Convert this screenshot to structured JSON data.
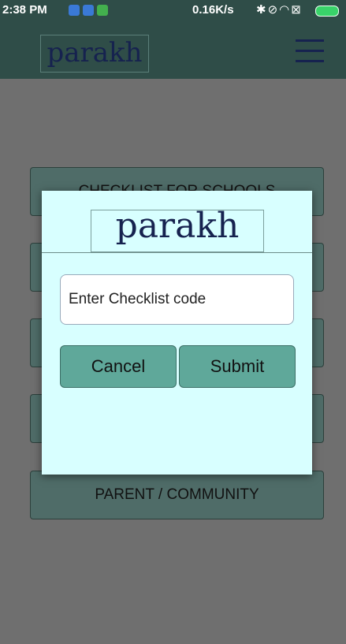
{
  "status_bar": {
    "time": "2:38 PM",
    "network_speed": "0.16K/s",
    "icons": [
      "bluetooth-icon",
      "mute-icon",
      "wifi-icon",
      "sim-icon",
      "battery-icon"
    ]
  },
  "app_bar": {
    "logo_text": "parakh",
    "menu_icon": "hamburger-menu-icon"
  },
  "background_menu": {
    "items": [
      {
        "label": "CHECKLIST FOR SCHOOLS"
      },
      {
        "label": ""
      },
      {
        "label": ""
      },
      {
        "label": ""
      },
      {
        "label": "PARENT / COMMUNITY"
      }
    ]
  },
  "dialog": {
    "logo_text": "parakh",
    "input_placeholder": "Enter Checklist code",
    "cancel_label": "Cancel",
    "submit_label": "Submit"
  },
  "colors": {
    "app_bar": "#2f4d48",
    "scrim_background": "#6f6f6f",
    "dialog_background": "#d8ffff",
    "button_background": "#5fa89a",
    "logo_color": "#16224f"
  }
}
